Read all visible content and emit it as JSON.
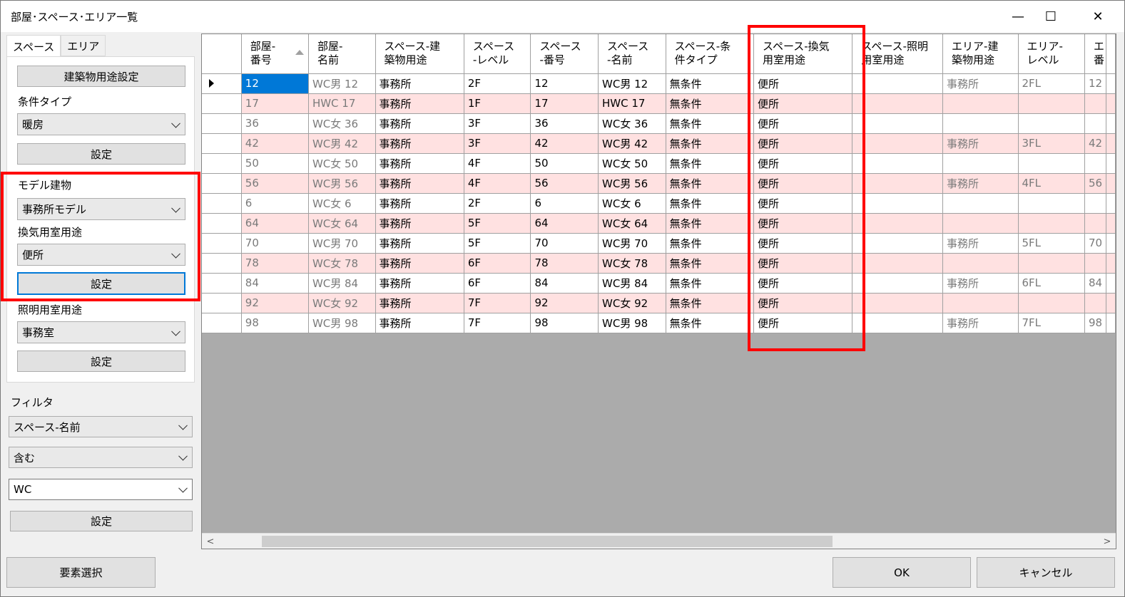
{
  "window": {
    "title": "部屋･スペース･エリア一覧",
    "min": "—",
    "max": "☐",
    "close": "✕"
  },
  "tabs": [
    {
      "label": "スペース"
    },
    {
      "label": "エリア"
    }
  ],
  "panel": {
    "building_use_btn": "建築物用途設定",
    "condition_type_label": "条件タイプ",
    "condition_type_value": "暖房",
    "set_btn": "設定",
    "model_label": "モデル建物",
    "model_value": "事務所モデル",
    "vent_label": "換気用室用途",
    "vent_value": "便所",
    "light_label": "照明用室用途",
    "light_value": "事務室"
  },
  "filter": {
    "label": "フィルタ",
    "field_value": "スペース-名前",
    "op_value": "含む",
    "text_value": "WC",
    "set_btn": "設定"
  },
  "footer": {
    "select_btn": "要素選択",
    "ok": "OK",
    "cancel": "キャンセル"
  },
  "grid": {
    "headers": [
      [
        "部屋-",
        "番号"
      ],
      [
        "部屋-",
        "名前"
      ],
      [
        "スペース-建",
        "築物用途"
      ],
      [
        "スペース",
        "-レベル"
      ],
      [
        "スペース",
        "-番号"
      ],
      [
        "スペース",
        "-名前"
      ],
      [
        "スペース-条",
        "件タイプ"
      ],
      [
        "スペース-換気",
        "用室用途"
      ],
      [
        "スペース-照明",
        "用室用途"
      ],
      [
        "エリア-建",
        "築物用途"
      ],
      [
        "エリア-",
        "レベル"
      ],
      [
        "エ",
        "番"
      ]
    ],
    "rows": [
      [
        "12",
        "WC男 12",
        "事務所",
        "2F",
        "12",
        "WC男 12",
        "無条件",
        "便所",
        "",
        "事務所",
        "2FL",
        "12"
      ],
      [
        "17",
        "HWC 17",
        "事務所",
        "1F",
        "17",
        "HWC 17",
        "無条件",
        "便所",
        "",
        "",
        "",
        ""
      ],
      [
        "36",
        "WC女 36",
        "事務所",
        "3F",
        "36",
        "WC女 36",
        "無条件",
        "便所",
        "",
        "",
        "",
        ""
      ],
      [
        "42",
        "WC男 42",
        "事務所",
        "3F",
        "42",
        "WC男 42",
        "無条件",
        "便所",
        "",
        "事務所",
        "3FL",
        "42"
      ],
      [
        "50",
        "WC女 50",
        "事務所",
        "4F",
        "50",
        "WC女 50",
        "無条件",
        "便所",
        "",
        "",
        "",
        ""
      ],
      [
        "56",
        "WC男 56",
        "事務所",
        "4F",
        "56",
        "WC男 56",
        "無条件",
        "便所",
        "",
        "事務所",
        "4FL",
        "56"
      ],
      [
        "6",
        "WC女 6",
        "事務所",
        "2F",
        "6",
        "WC女 6",
        "無条件",
        "便所",
        "",
        "",
        "",
        ""
      ],
      [
        "64",
        "WC女 64",
        "事務所",
        "5F",
        "64",
        "WC女 64",
        "無条件",
        "便所",
        "",
        "",
        "",
        ""
      ],
      [
        "70",
        "WC男 70",
        "事務所",
        "5F",
        "70",
        "WC男 70",
        "無条件",
        "便所",
        "",
        "事務所",
        "5FL",
        "70"
      ],
      [
        "78",
        "WC女 78",
        "事務所",
        "6F",
        "78",
        "WC女 78",
        "無条件",
        "便所",
        "",
        "",
        "",
        ""
      ],
      [
        "84",
        "WC男 84",
        "事務所",
        "6F",
        "84",
        "WC男 84",
        "無条件",
        "便所",
        "",
        "事務所",
        "6FL",
        "84"
      ],
      [
        "92",
        "WC女 92",
        "事務所",
        "7F",
        "92",
        "WC女 92",
        "無条件",
        "便所",
        "",
        "",
        "",
        ""
      ],
      [
        "98",
        "WC男 98",
        "事務所",
        "7F",
        "98",
        "WC男 98",
        "無条件",
        "便所",
        "",
        "事務所",
        "7FL",
        "98"
      ]
    ],
    "scroll_left": "<",
    "scroll_right": ">"
  }
}
